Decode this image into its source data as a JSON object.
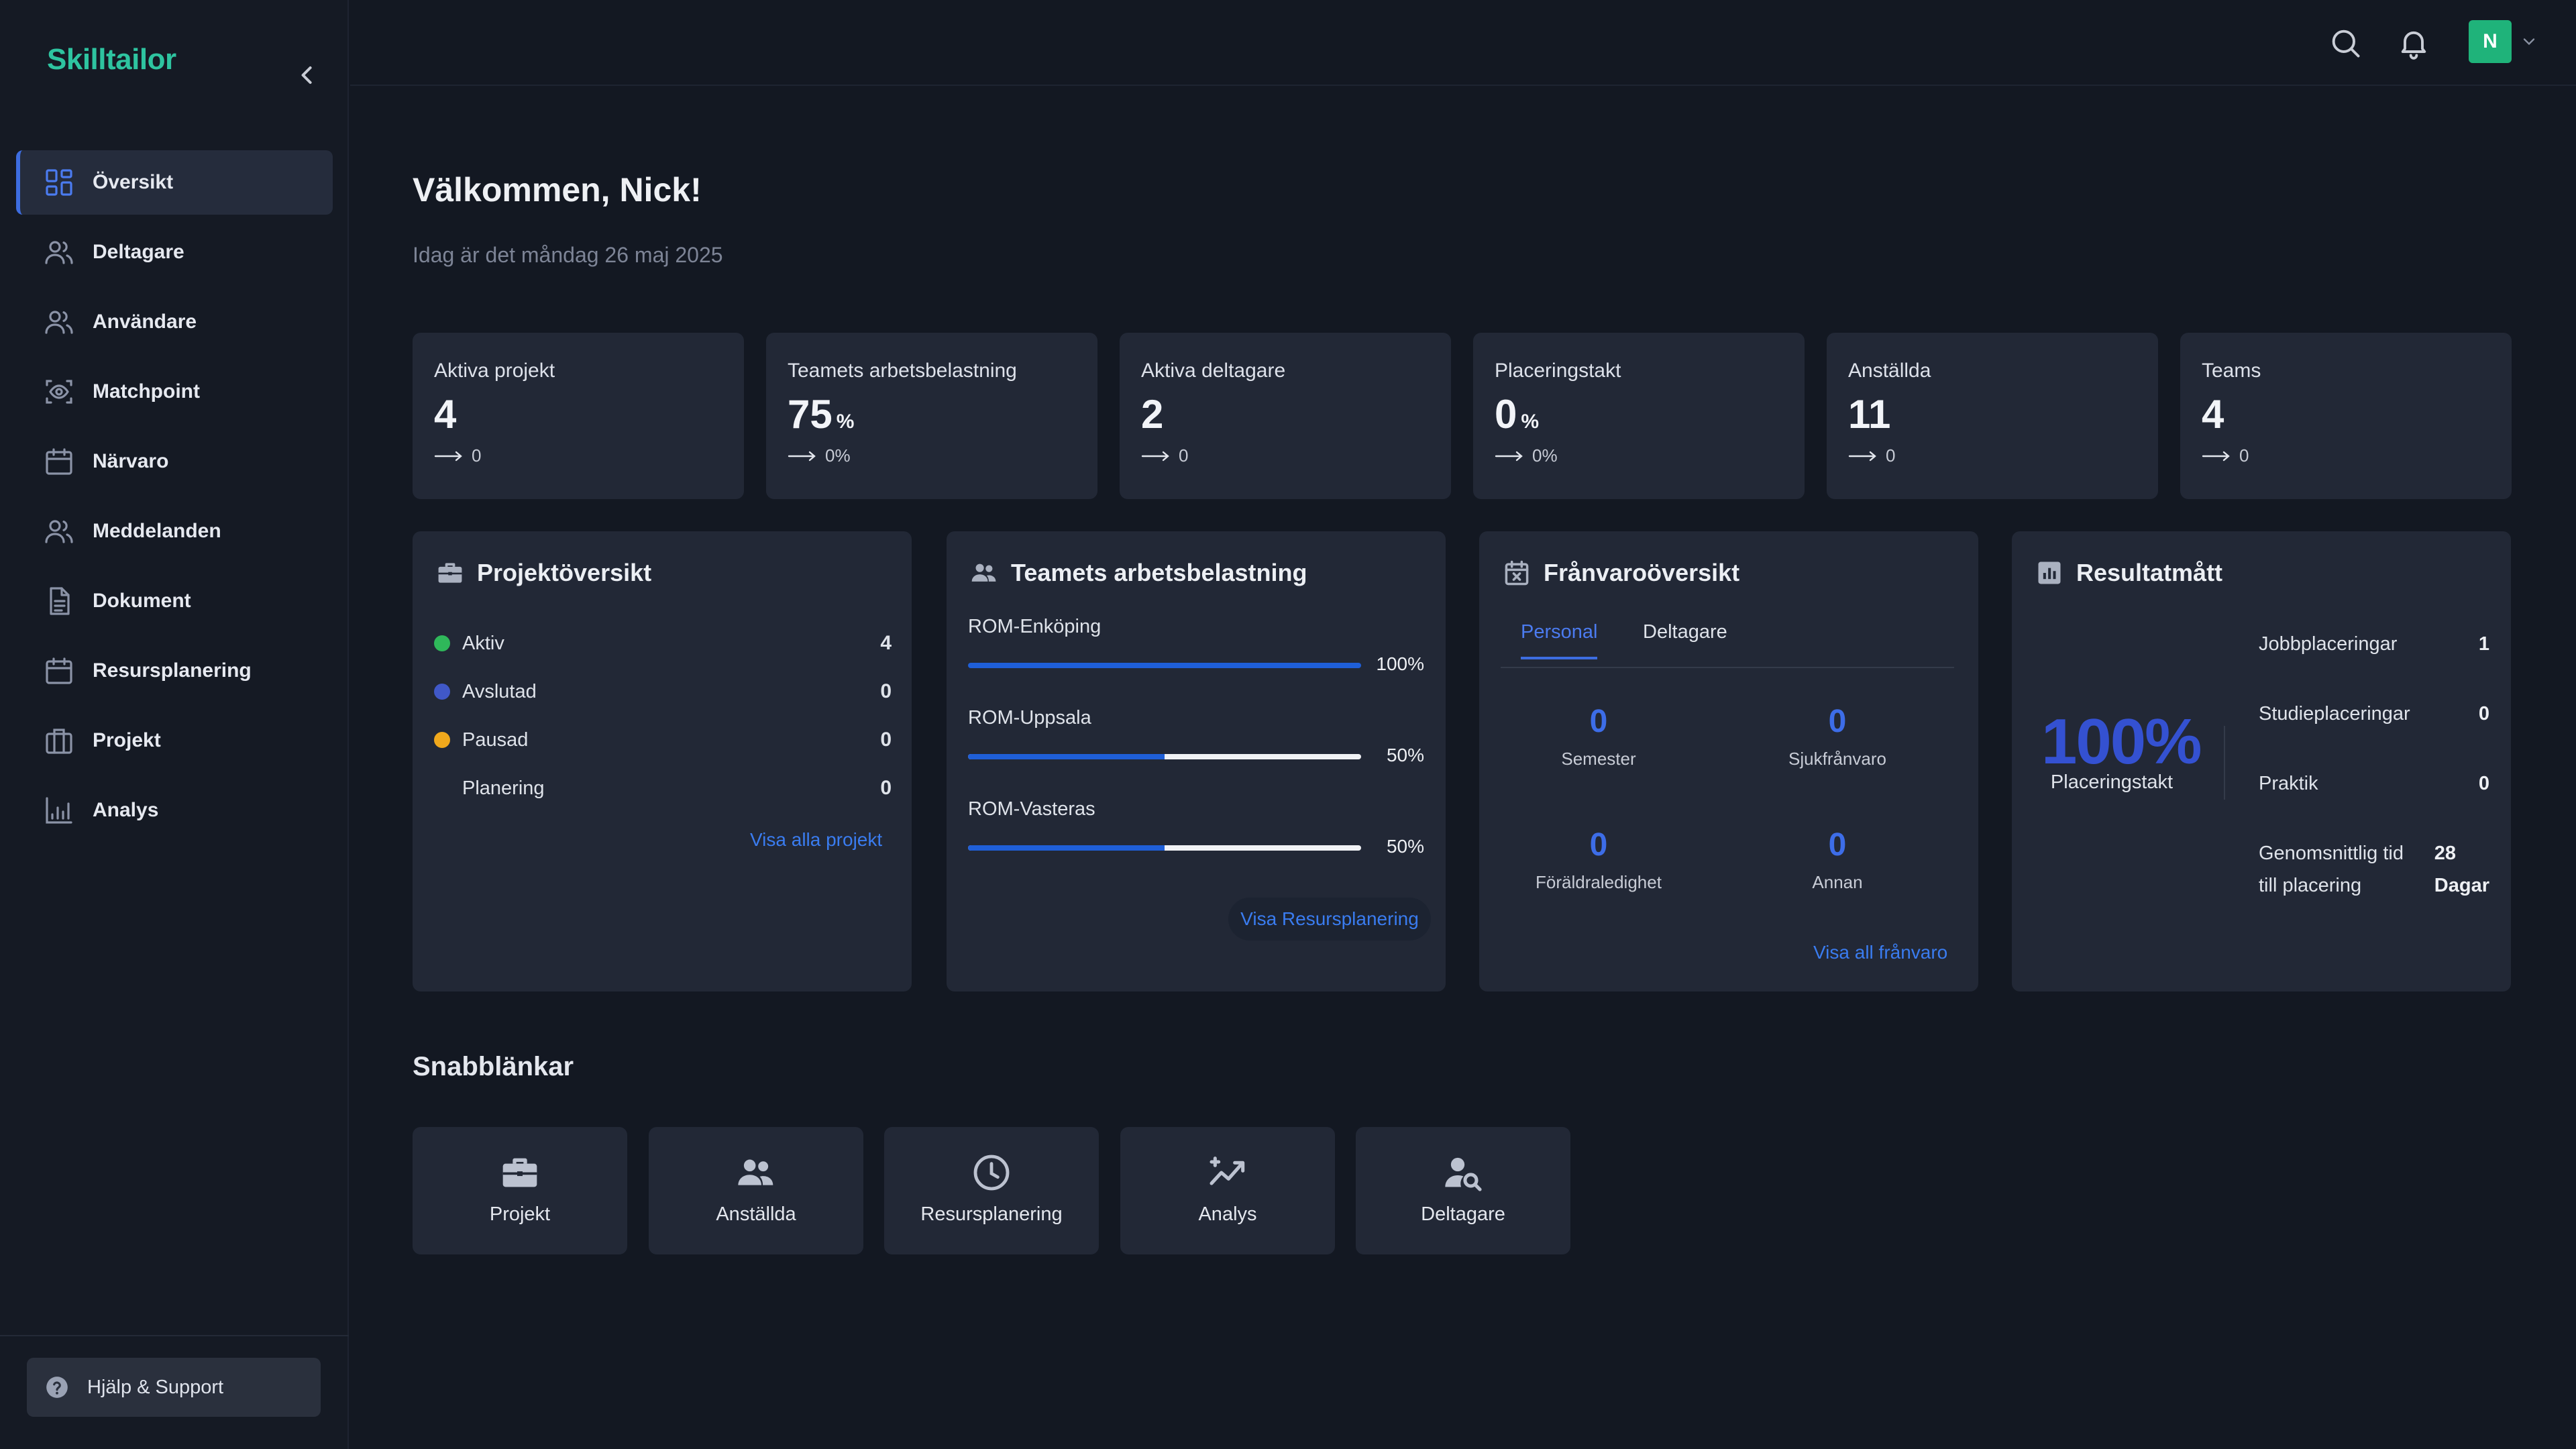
{
  "app": {
    "name": "Skilltailor"
  },
  "sidebar": {
    "items": [
      {
        "label": "Översikt",
        "icon": "dashboard-icon",
        "active": true
      },
      {
        "label": "Deltagare",
        "icon": "users-icon"
      },
      {
        "label": "Användare",
        "icon": "users-icon"
      },
      {
        "label": "Matchpoint",
        "icon": "eye-scan-icon"
      },
      {
        "label": "Närvaro",
        "icon": "calendar-icon"
      },
      {
        "label": "Meddelanden",
        "icon": "users-icon"
      },
      {
        "label": "Dokument",
        "icon": "document-icon"
      },
      {
        "label": "Resursplanering",
        "icon": "calendar-icon"
      },
      {
        "label": "Projekt",
        "icon": "briefcase-icon"
      },
      {
        "label": "Analys",
        "icon": "chart-icon"
      }
    ],
    "help_label": "Hjälp & Support"
  },
  "header": {
    "avatar_initial": "N"
  },
  "main": {
    "welcome": "Välkommen, Nick!",
    "date": "Idag är det måndag 26 maj 2025"
  },
  "stats": [
    {
      "label": "Aktiva projekt",
      "value": "4",
      "unit": "",
      "trend": "0"
    },
    {
      "label": "Teamets arbetsbelastning",
      "value": "75",
      "unit": "%",
      "trend": "0%"
    },
    {
      "label": "Aktiva deltagare",
      "value": "2",
      "unit": "",
      "trend": "0"
    },
    {
      "label": "Placeringstakt",
      "value": "0",
      "unit": "%",
      "trend": "0%"
    },
    {
      "label": "Anställda",
      "value": "11",
      "unit": "",
      "trend": "0"
    },
    {
      "label": "Teams",
      "value": "4",
      "unit": "",
      "trend": "0"
    }
  ],
  "projects": {
    "title": "Projektöversikt",
    "rows": [
      {
        "label": "Aktiv",
        "value": "4",
        "color": "#2fb85a"
      },
      {
        "label": "Avslutad",
        "value": "0",
        "color": "#4058c8"
      },
      {
        "label": "Pausad",
        "value": "0",
        "color": "#f0a81c"
      },
      {
        "label": "Planering",
        "value": "0",
        "color": ""
      }
    ],
    "link": "Visa alla projekt"
  },
  "workload": {
    "title": "Teamets arbetsbelastning",
    "teams": [
      {
        "name": "ROM-Enköping",
        "percent": 100,
        "label": "100%"
      },
      {
        "name": "ROM-Uppsala",
        "percent": 50,
        "label": "50%"
      },
      {
        "name": "ROM-Vasteras",
        "percent": 50,
        "label": "50%"
      }
    ],
    "button": "Visa Resursplanering"
  },
  "absence": {
    "title": "Frånvaroöversikt",
    "tabs": [
      "Personal",
      "Deltagare"
    ],
    "items": [
      {
        "value": "0",
        "label": "Semester"
      },
      {
        "value": "0",
        "label": "Sjukfrånvaro"
      },
      {
        "value": "0",
        "label": "Föräldraledighet"
      },
      {
        "value": "0",
        "label": "Annan"
      }
    ],
    "link": "Visa all frånvaro"
  },
  "results": {
    "title": "Resultatmått",
    "big_value": "100%",
    "big_label": "Placeringstakt",
    "rows": [
      {
        "label": "Jobbplaceringar",
        "value": "1"
      },
      {
        "label": "Studieplaceringar",
        "value": "0"
      },
      {
        "label": "Praktik",
        "value": "0"
      }
    ],
    "avg_label_line1": "Genomsnittlig tid",
    "avg_label_line2": "till placering",
    "avg_value_line1": "28",
    "avg_value_line2": "Dagar"
  },
  "quicklinks": {
    "title": "Snabblänkar",
    "items": [
      {
        "label": "Projekt",
        "icon": "briefcase-icon"
      },
      {
        "label": "Anställda",
        "icon": "people-icon"
      },
      {
        "label": "Resursplanering",
        "icon": "clock-icon"
      },
      {
        "label": "Analys",
        "icon": "trending-icon"
      },
      {
        "label": "Deltagare",
        "icon": "person-search-icon"
      }
    ]
  },
  "colors": {
    "accent": "#3d6de0",
    "brand": "#2ec4a0",
    "background": "#131822",
    "card": "#222836"
  }
}
